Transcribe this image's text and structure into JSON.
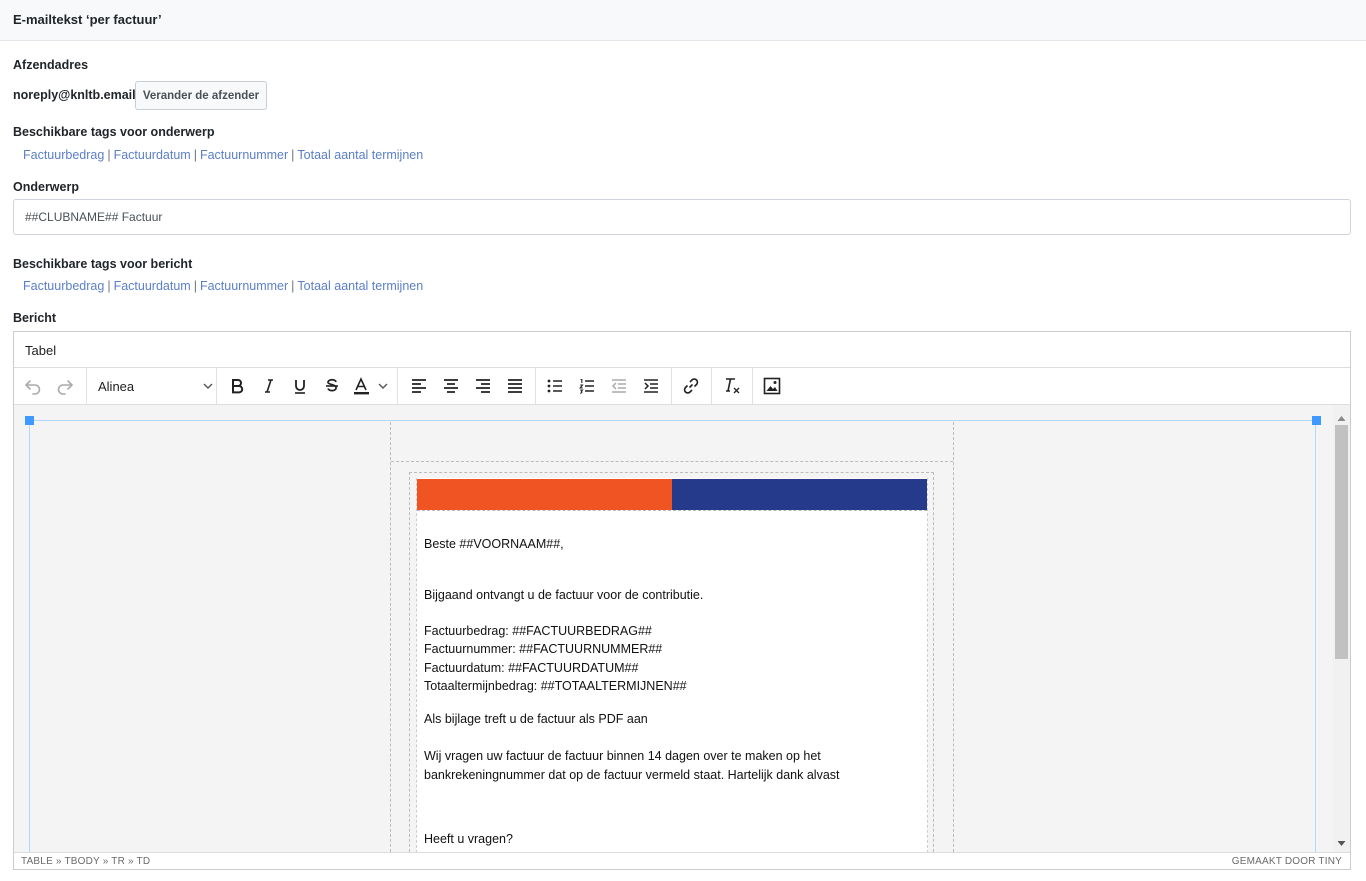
{
  "header": {
    "title": "E-mailtekst ‘per factuur’"
  },
  "sender": {
    "label": "Afzendadres",
    "email": "noreply@knltb.email",
    "change_button": "Verander de afzender"
  },
  "subject_tags": {
    "label": "Beschikbare tags voor onderwerp",
    "tags": [
      "Factuurbedrag",
      "Factuurdatum",
      "Factuurnummer",
      "Totaal aantal termijnen"
    ]
  },
  "subject": {
    "label": "Onderwerp",
    "value": "##CLUBNAME## Factuur"
  },
  "message_tags": {
    "label": "Beschikbare tags voor bericht",
    "tags": [
      "Factuurbedrag",
      "Factuurdatum",
      "Factuurnummer",
      "Totaal aantal termijnen"
    ]
  },
  "message": {
    "label": "Bericht",
    "menubar": {
      "table_menu": "Tabel"
    },
    "toolbar": {
      "block_format": "Alinea",
      "buttons": [
        "undo-icon",
        "redo-icon",
        "bold-icon",
        "italic-icon",
        "underline-icon",
        "strikethrough-icon",
        "text-color-icon",
        "align-left-icon",
        "align-center-icon",
        "align-right-icon",
        "align-justify-icon",
        "bullet-list-icon",
        "numbered-list-icon",
        "outdent-icon",
        "indent-icon",
        "link-icon",
        "clear-format-icon",
        "image-icon"
      ]
    },
    "content": {
      "banner_colors": {
        "left": "#f05423",
        "right": "#263a8c"
      },
      "greeting": "Beste ##VOORNAAM##,",
      "intro": "Bijgaand ontvangt u de factuur voor de contributie.",
      "line_amount": "Factuurbedrag: ##FACTUURBEDRAG##",
      "line_number": "Factuurnummer: ##FACTUURNUMMER##",
      "line_date": "Factuurdatum: ##FACTUURDATUM##",
      "line_total": "Totaaltermijnbedrag: ##TOTAALTERMIJNEN##",
      "attachment": "Als bijlage treft u de factuur als PDF aan",
      "payment_1": "Wij vragen uw factuur de factuur binnen 14 dagen over te maken op het",
      "payment_2": "bankrekeningnummer dat op de factuur vermeld staat. Hartelijk dank alvast",
      "questions": "Heeft u vragen?"
    },
    "statusbar": {
      "path": "TABLE » TBODY » TR » TD",
      "brand": "GEMAAKT DOOR TINY"
    }
  }
}
